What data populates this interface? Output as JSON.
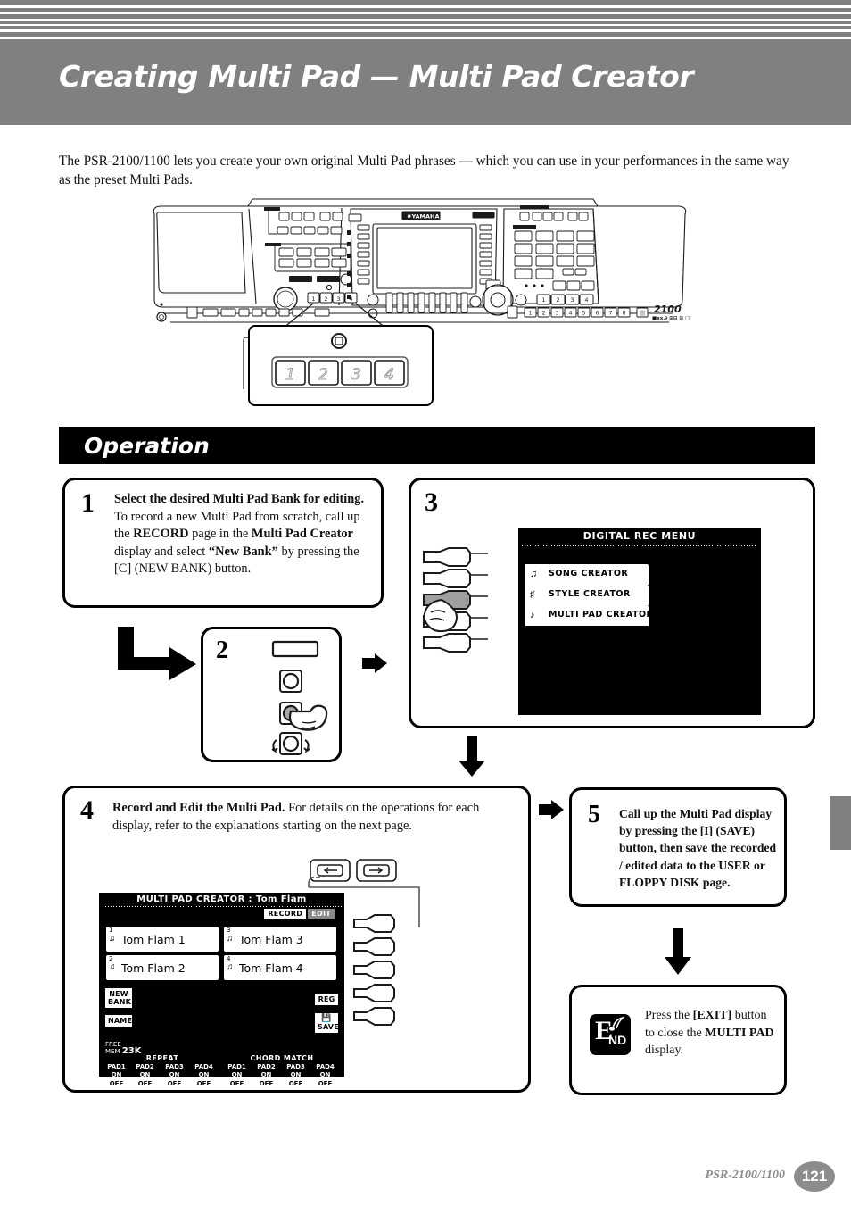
{
  "page": {
    "title": "Creating Multi Pad — Multi Pad Creator",
    "intro": "The PSR-2100/1100 lets you create your own original Multi Pad phrases — which you can use in your performances in the same way as the preset Multi Pads.",
    "section_header": "Operation",
    "footer_model": "PSR-2100/1100",
    "footer_page": "121",
    "colors": {
      "header_gray": "#808080",
      "section_black": "#000000",
      "footer_gray": "#8c8c8c"
    }
  },
  "keyboard": {
    "brand": "YAMAHA",
    "model_mark": "2100",
    "callout_pads": [
      "1",
      "2",
      "3",
      "4"
    ],
    "multipad_numbers_left": [
      "1",
      "2",
      "3",
      "4"
    ],
    "multipad_numbers_right": [
      "1",
      "2",
      "3",
      "4"
    ],
    "bottom_numbers": [
      "1",
      "2",
      "3",
      "4",
      "5",
      "6",
      "7",
      "8"
    ]
  },
  "steps": {
    "step1": {
      "number": "1",
      "text_runs": [
        {
          "t": "Select the desired Multi Pad Bank for editing.",
          "b": true
        },
        {
          "t": " To record a new Multi Pad from scratch, call up the ",
          "b": false
        },
        {
          "t": "RECORD",
          "b": true
        },
        {
          "t": " page in the ",
          "b": false
        },
        {
          "t": "Multi Pad Creator",
          "b": true
        },
        {
          "t": " display and select ",
          "b": false
        },
        {
          "t": "“New Bank”",
          "b": true
        },
        {
          "t": " by pressing the [C] (NEW BANK) button.",
          "b": false
        }
      ]
    },
    "step2": {
      "number": "2"
    },
    "step3": {
      "number": "3",
      "lcd": {
        "title": "DIGITAL REC MENU",
        "menu_items": [
          {
            "label": "SONG CREATOR",
            "icon": "note-icon"
          },
          {
            "label": "STYLE CREATOR",
            "icon": "style-icon"
          },
          {
            "label": "MULTI PAD CREATOR",
            "icon": "pad-icon"
          }
        ],
        "selected_index": 2
      }
    },
    "step4": {
      "number": "4",
      "text_runs": [
        {
          "t": "Record and Edit the Multi Pad.",
          "b": true
        },
        {
          "t": " For details on the operations for each display, refer to the explanations starting on the next page.",
          "b": false
        }
      ],
      "lcd": {
        "title": "MULTI PAD CREATOR : Tom Flam",
        "tabs": [
          {
            "label": "RECORD",
            "active": false
          },
          {
            "label": "EDIT",
            "active": true
          }
        ],
        "pads": [
          {
            "num": "1",
            "name": "Tom Flam 1"
          },
          {
            "num": "2",
            "name": "Tom Flam 2"
          },
          {
            "num": "3",
            "name": "Tom Flam 3"
          },
          {
            "num": "4",
            "name": "Tom Flam 4"
          }
        ],
        "left_buttons": [
          {
            "label": "NEW\nBANK"
          },
          {
            "label": "NAME"
          }
        ],
        "right_buttons": [
          {
            "label": "REG"
          },
          {
            "label": "SAVE",
            "icon": "floppy-icon"
          }
        ],
        "free_memory_label": "FREE\nMEM",
        "free_memory_value": "23K",
        "sections": [
          {
            "name": "REPEAT",
            "pads": [
              {
                "name": "PAD1",
                "on": "ON",
                "off": "OFF"
              },
              {
                "name": "PAD2",
                "on": "ON",
                "off": "OFF"
              },
              {
                "name": "PAD3",
                "on": "ON",
                "off": "OFF"
              },
              {
                "name": "PAD4",
                "on": "ON",
                "off": "OFF"
              }
            ]
          },
          {
            "name": "CHORD MATCH",
            "pads": [
              {
                "name": "PAD1",
                "on": "ON",
                "off": "OFF"
              },
              {
                "name": "PAD2",
                "on": "ON",
                "off": "OFF"
              },
              {
                "name": "PAD3",
                "on": "ON",
                "off": "OFF"
              },
              {
                "name": "PAD4",
                "on": "ON",
                "off": "OFF"
              }
            ]
          }
        ],
        "updown_glyph": "▲▼"
      }
    },
    "step5": {
      "number": "5",
      "text_runs": [
        {
          "t": "Call up the Multi Pad display by pressing the [I] (SAVE) button, then save the recorded / edited data to the USER or FLOPPY DISK page.",
          "b": true
        }
      ]
    },
    "end": {
      "badge_e": "E",
      "badge_nd": "ND",
      "text_runs": [
        {
          "t": "Press the ",
          "b": false
        },
        {
          "t": "[EXIT]",
          "b": true
        },
        {
          "t": " button to close the ",
          "b": false
        },
        {
          "t": "MULTI PAD",
          "b": true
        },
        {
          "t": " display.",
          "b": false
        }
      ]
    }
  }
}
